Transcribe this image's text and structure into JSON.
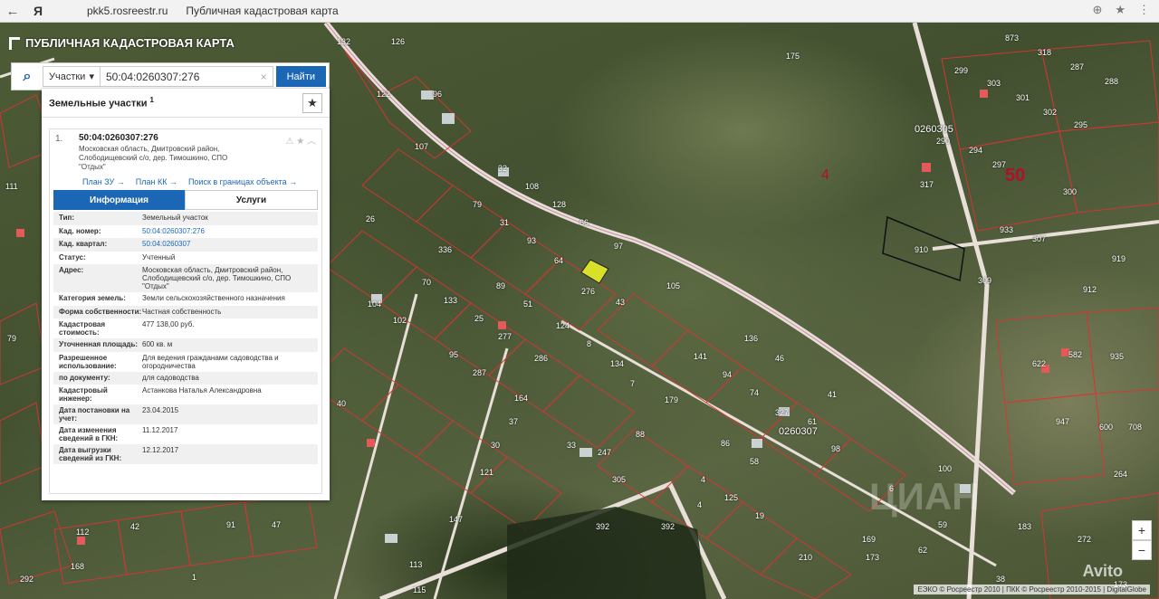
{
  "browser": {
    "back": "←",
    "logo": "Я",
    "url": "pkk5.rosreestr.ru",
    "page_title": "Публичная кадастровая карта",
    "icons": [
      "lock-icon",
      "translate-icon",
      "star-icon",
      "menu-icon"
    ]
  },
  "app": {
    "title": "ПУБЛИЧНАЯ КАДАСТРОВАЯ КАРТА"
  },
  "search": {
    "type_label": "Участки",
    "query": "50:04:0260307:276",
    "clear": "×",
    "button": "Найти"
  },
  "panel": {
    "title": "Земельные участки",
    "count": "1",
    "item": {
      "index": "1.",
      "cadnum": "50:04:0260307:276",
      "address_lines": [
        "Московская область, Дмитровский район,",
        "Слободищевский с/о, дер. Тимошкино, СПО",
        "\"Отдых\""
      ],
      "links": [
        "План ЗУ →",
        "План КК →",
        "Поиск в границах объекта →"
      ],
      "tabs": [
        "Информация",
        "Услуги"
      ],
      "rows": [
        {
          "k": "Тип:",
          "v": "Земельный участок"
        },
        {
          "k": "Кад. номер:",
          "v": "50:04:0260307:276"
        },
        {
          "k": "Кад. квартал:",
          "v": "50:04:0260307"
        },
        {
          "k": "Статус:",
          "v": "Учтенный"
        },
        {
          "k": "Адрес:",
          "v": "Московская область, Дмитровский район, Слободищевский с/о, дер. Тимошкино, СПО \"Отдых\""
        },
        {
          "k": "Категория земель:",
          "v": "Земли сельскохозяйственного назначения"
        },
        {
          "k": "Форма собственности:",
          "v": "Частная собственность"
        },
        {
          "k": "Кадастровая стоимость:",
          "v": "477 138,00 руб."
        },
        {
          "k": "Уточненная площадь:",
          "v": "600 кв. м"
        },
        {
          "k": "Разрешенное использование:",
          "v": "Для ведения гражданами садоводства и огородничества"
        },
        {
          "k": "по документу:",
          "v": "для садоводства"
        },
        {
          "k": "Кадастровый инженер:",
          "v": "Астанкова Наталья Александровна"
        },
        {
          "k": "Дата постановки на учет:",
          "v": "23.04.2015"
        },
        {
          "k": "Дата изменения сведений в ГКН:",
          "v": "11.12.2017"
        },
        {
          "k": "Дата выгрузки сведений из ГКН:",
          "v": "12.12.2017"
        }
      ]
    }
  },
  "map": {
    "parcel_labels": [
      "132",
      "126",
      "122",
      "96",
      "107",
      "32",
      "108",
      "79",
      "31",
      "93",
      "128",
      "66",
      "97",
      "64",
      "336",
      "70",
      "89",
      "133",
      "25",
      "51",
      "104",
      "102",
      "124",
      "277",
      "8",
      "286",
      "134",
      "95",
      "287",
      "7",
      "164",
      "179",
      "141",
      "94",
      "136",
      "46",
      "74",
      "327",
      "61",
      "41",
      "37",
      "30",
      "33",
      "247",
      "88",
      "86",
      "58",
      "98",
      "121",
      "305",
      "392",
      "147",
      "113",
      "4",
      "125",
      "19",
      "210",
      "100",
      "6",
      "115",
      "392",
      "91",
      "47",
      "42",
      "112",
      "168",
      "292",
      "1",
      "4",
      "873",
      "318",
      "287",
      "288",
      "299",
      "303",
      "301",
      "302",
      "295",
      "290",
      "294",
      "297",
      "300",
      "317",
      "933",
      "307",
      "910",
      "309",
      "919",
      "912",
      "622",
      "582",
      "935",
      "947",
      "600",
      "708",
      "264",
      "183",
      "272",
      "62",
      "169",
      "173",
      "59",
      "38",
      "26",
      "105",
      "43",
      "276",
      "175",
      "40",
      "111",
      "129",
      "79",
      "173"
    ],
    "quarter_label": "0260307",
    "quarter_label_2": "0260305",
    "big_numbers": [
      "50",
      "4"
    ],
    "zoom_in": "+",
    "zoom_out": "−",
    "attribution": "ЕЭКО © Росреестр 2010 | ПКК © Росреестр 2010-2015 | DigitalGlobe",
    "watermark": "ЦИАН",
    "avito": "Avito"
  }
}
